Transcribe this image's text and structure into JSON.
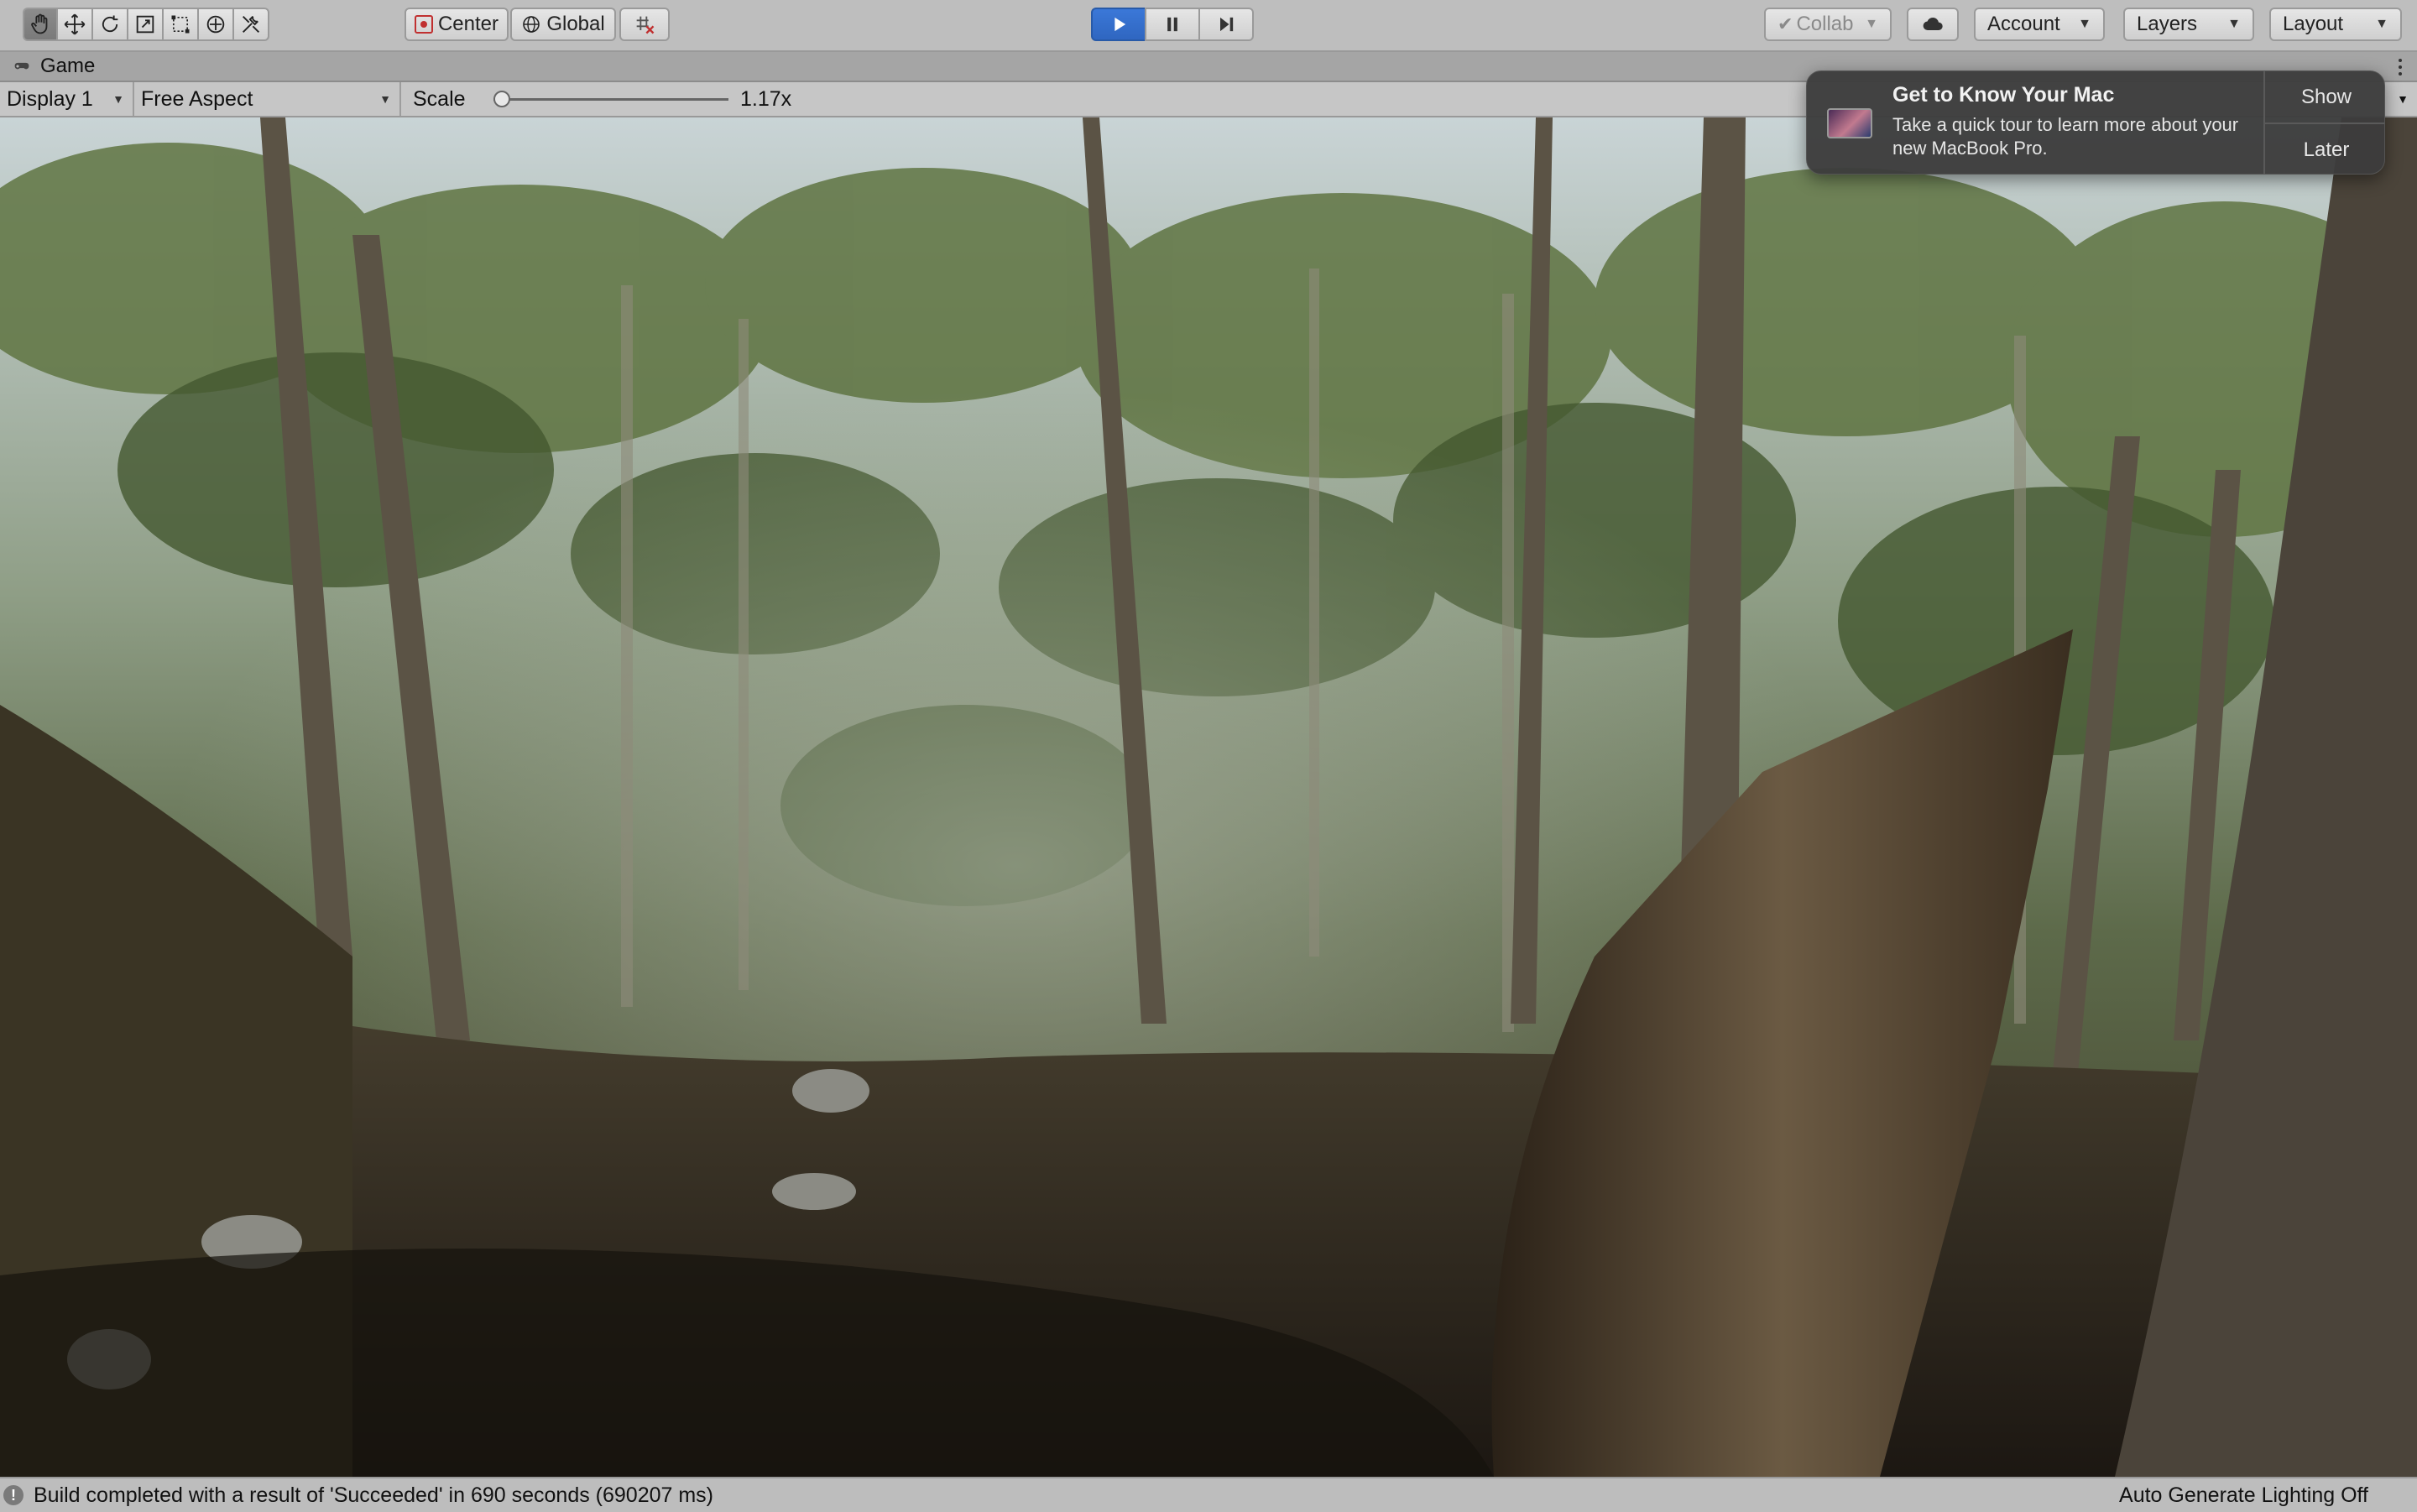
{
  "toolbar": {
    "tools": [
      {
        "name": "hand-tool",
        "icon": "hand-icon"
      },
      {
        "name": "move-tool",
        "icon": "move-arrows-icon"
      },
      {
        "name": "rotate-tool",
        "icon": "rotate-icon"
      },
      {
        "name": "scale-tool",
        "icon": "scale-icon"
      },
      {
        "name": "rect-tool",
        "icon": "rect-transform-icon"
      },
      {
        "name": "transform-tool",
        "icon": "transform-icon"
      },
      {
        "name": "custom-tool",
        "icon": "custom-tools-icon"
      }
    ],
    "pivot_label": "Center",
    "space_label": "Global",
    "snap_icon": "grid-snap-icon",
    "play_icon": "play-icon",
    "pause_icon": "pause-icon",
    "step_icon": "step-icon",
    "collab_label": "Collab",
    "cloud_icon": "cloud-icon",
    "account_label": "Account",
    "layers_label": "Layers",
    "layout_label": "Layout"
  },
  "tab": {
    "label": "Game",
    "icon": "game-controller-icon",
    "menu_icon": "kebab-menu-icon"
  },
  "game_bar": {
    "display_label": "Display 1",
    "aspect_label": "Free Aspect",
    "scale_label": "Scale",
    "scale_value": "1.17x",
    "scale_fraction": 0.0
  },
  "notification": {
    "title": "Get to Know Your Mac",
    "body": "Take a quick tour to learn more about your new MacBook Pro.",
    "show_label": "Show",
    "later_label": "Later",
    "icon": "macbook-icon"
  },
  "status": {
    "message": "Build completed with a result of 'Succeeded' in 690 seconds (690207 ms)",
    "icon": "info-icon",
    "icon_glyph": "!",
    "lighting": "Auto Generate Lighting Off"
  },
  "colors": {
    "play_active": "#3b78d8",
    "toolbar_bg": "#bebebe",
    "notification_bg": "#3c3c3c"
  }
}
